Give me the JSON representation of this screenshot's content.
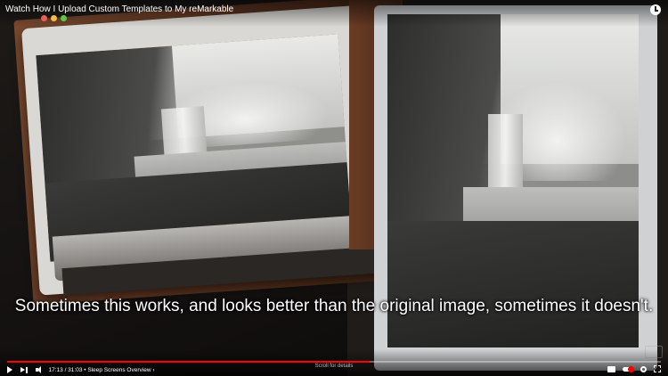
{
  "window": {
    "title": "Watch How I Upload Custom Templates to My reMarkable"
  },
  "subtitle": {
    "text": "Sometimes this works, and looks better than the original image, sometimes it doesn't."
  },
  "player": {
    "time": "17:13 / 31:03 • Sleep Screens Overview ›",
    "scroll_hint": "Scroll for details",
    "progress": 0.555
  },
  "icons": {
    "play": "play-icon",
    "next": "next-icon",
    "volume": "volume-icon",
    "clock": "clock-icon",
    "captions": "cc-icon",
    "autoplay": "toggle-icon",
    "settings": "gear-icon",
    "fullscreen": "fullscreen-icon"
  },
  "colors": {
    "progress": "#ff0000",
    "caption": "#ffffff"
  }
}
